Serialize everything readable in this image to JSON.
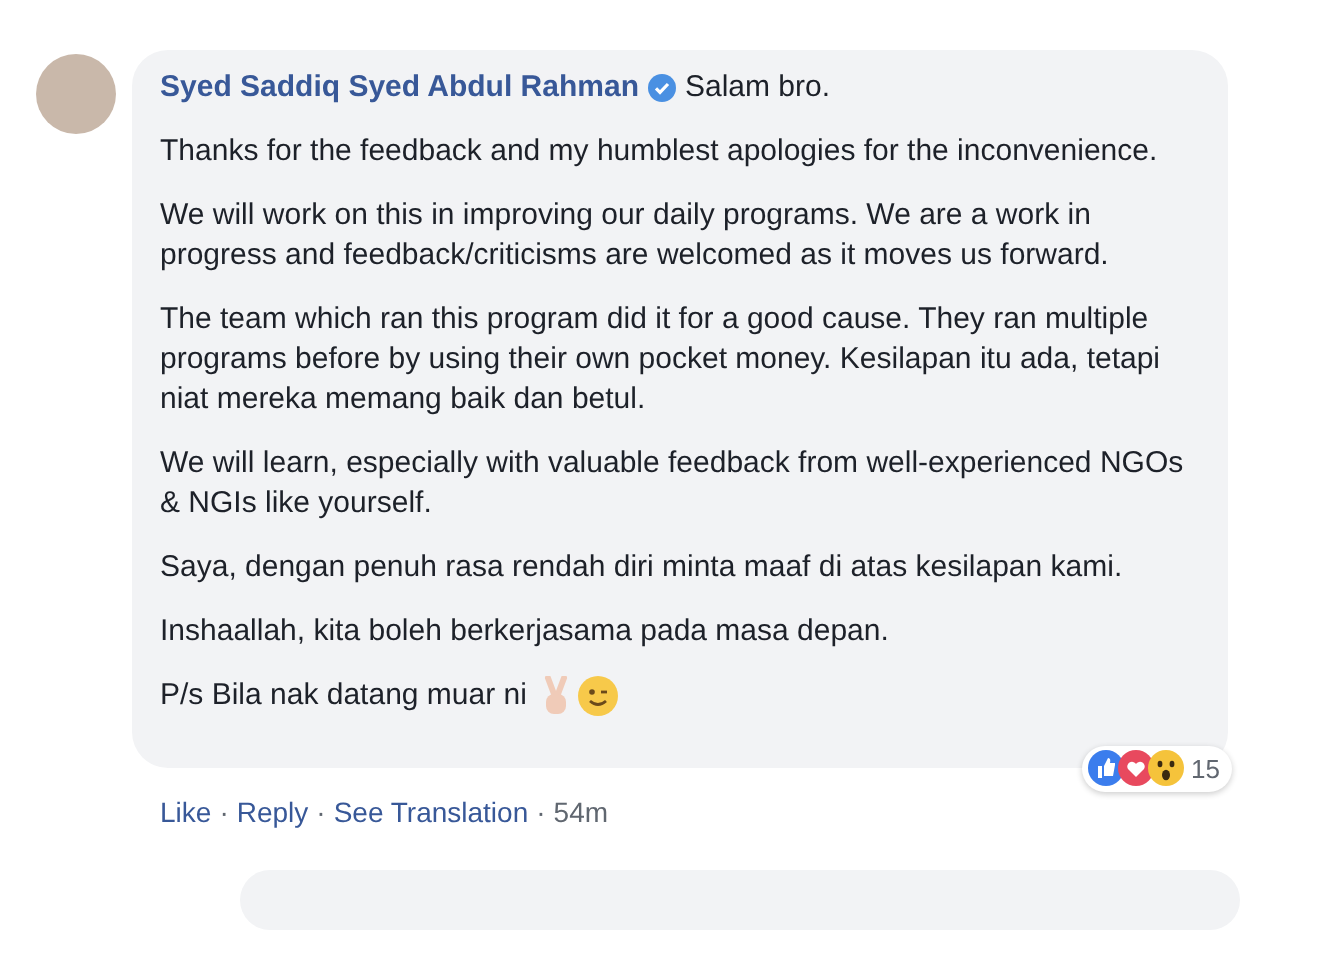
{
  "comment": {
    "author": "Syed Saddiq Syed Abdul Rahman",
    "verified": true,
    "first_line": "Salam bro.",
    "paragraphs": [
      "Thanks for the feedback and my humblest apologies for the inconvenience.",
      "We will work on this in improving our daily programs. We are a work in progress and feedback/criticisms are welcomed as it moves us forward.",
      "The team which ran this program did it for a good cause. They ran multiple programs before by using their own pocket money. Kesilapan itu ada, tetapi niat mereka memang baik dan betul.",
      "We will learn, especially with valuable feedback from well-experienced NGOs & NGIs like yourself.",
      "Saya, dengan penuh rasa rendah diri minta maaf di atas kesilapan kami.",
      "Inshaallah, kita boleh berkerjasama pada masa depan.",
      "P/s Bila nak datang muar ni"
    ],
    "reaction_count": "15",
    "actions": [
      "Like",
      "Reply",
      "See Translation",
      "54m"
    ],
    "separator": "·"
  }
}
